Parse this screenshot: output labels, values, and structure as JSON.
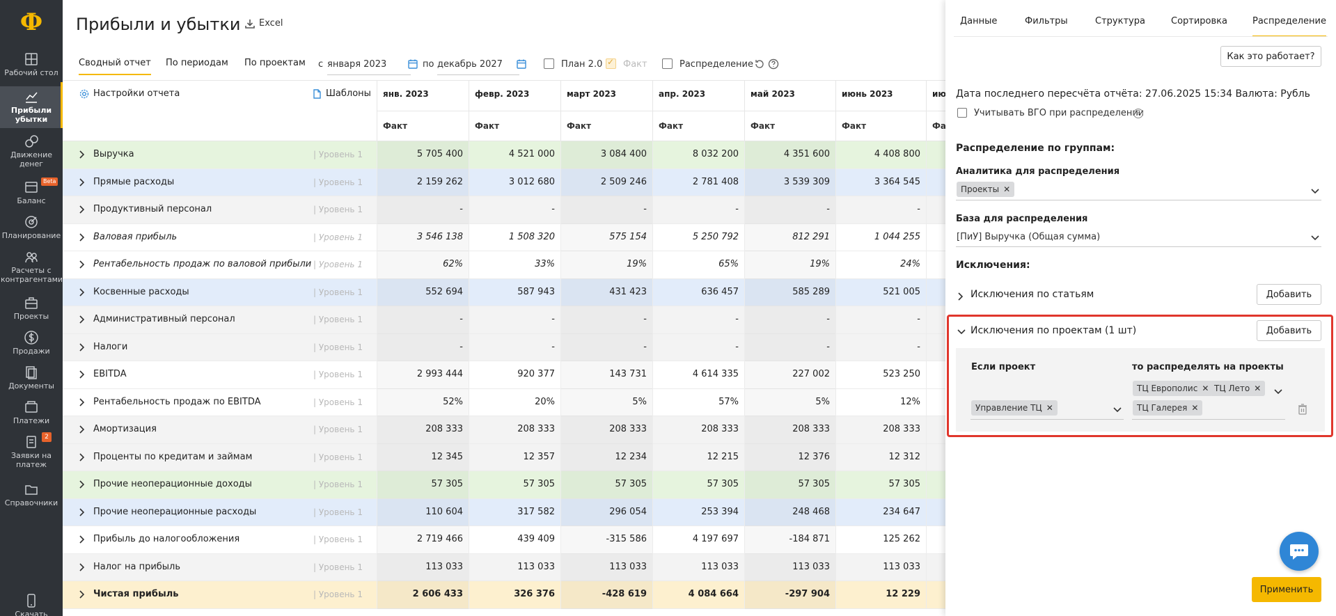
{
  "sidebar": {
    "logo": "Ф",
    "items": [
      {
        "label": "Рабочий стол",
        "icon": "dashboard-icon"
      },
      {
        "label": "Прибыли убытки",
        "icon": "chart-icon",
        "active": true
      },
      {
        "label": "Движение денег",
        "icon": "money-flow-icon"
      },
      {
        "label": "Баланс",
        "icon": "balance-icon",
        "badge": "Beta"
      },
      {
        "label": "Планирование",
        "icon": "target-icon"
      },
      {
        "label": "Расчеты с контрагентами",
        "icon": "contractors-icon"
      },
      {
        "label": "Проекты",
        "icon": "briefcase-icon"
      },
      {
        "label": "Продажи",
        "icon": "dollar-icon"
      },
      {
        "label": "Документы",
        "icon": "documents-icon"
      },
      {
        "label": "Платежи",
        "icon": "payments-icon"
      },
      {
        "label": "Заявки на платеж",
        "icon": "requests-icon",
        "badge": "2"
      },
      {
        "label": "Справочники",
        "icon": "folder-icon"
      },
      {
        "label": "Скачать",
        "icon": "phone-icon"
      }
    ]
  },
  "header": {
    "title": "Прибыли и убытки",
    "excel_label": "Excel"
  },
  "tabs": [
    {
      "label": "Сводный отчет",
      "active": true
    },
    {
      "label": "По периодам"
    },
    {
      "label": "По проектам"
    }
  ],
  "period": {
    "from_label": "с",
    "from_value": "января 2023",
    "to_label": "по",
    "to_value": "декабрь 2027"
  },
  "toggles": {
    "plan_label": "План 2.0",
    "fact_label": "Факт",
    "distribution_label": "Распределение"
  },
  "table": {
    "settings_label": "Настройки отчета",
    "templates_label": "Шаблоны",
    "months": [
      "янв. 2023",
      "февр. 2023",
      "март 2023",
      "апр. 2023",
      "май 2023",
      "июнь 2023",
      "июл"
    ],
    "sub_label": "Факт",
    "sub_label_cut": "Фа",
    "rows": [
      {
        "name": "Выручка",
        "level": "| Уровень 1",
        "style": "green",
        "bold": false,
        "values": [
          "5 705 400",
          "4 521 000",
          "3 084 400",
          "8 032 200",
          "4 351 600",
          "4 408 800"
        ]
      },
      {
        "name": "Прямые расходы",
        "level": "| Уровень 1",
        "style": "blue",
        "values": [
          "2 159 262",
          "3 012 680",
          "2 509 246",
          "2 781 408",
          "3 539 309",
          "3 364 545"
        ]
      },
      {
        "name": "Продуктивный персонал",
        "level": "| Уровень 1",
        "style": "gray",
        "values": [
          "-",
          "-",
          "-",
          "-",
          "-",
          "-"
        ]
      },
      {
        "name": "Валовая прибыль",
        "level": "| Уровень 1",
        "style": "white",
        "italic": true,
        "values": [
          "3 546 138",
          "1 508 320",
          "575 154",
          "5 250 792",
          "812 291",
          "1 044 255"
        ]
      },
      {
        "name": "Рентабельность продаж по валовой прибыли",
        "level": "| Уровень 1",
        "style": "white",
        "italic": true,
        "values": [
          "62%",
          "33%",
          "19%",
          "65%",
          "19%",
          "24%"
        ]
      },
      {
        "name": "Косвенные расходы",
        "level": "| Уровень 1",
        "style": "blue",
        "values": [
          "552 694",
          "587 943",
          "431 423",
          "636 457",
          "585 289",
          "521 005"
        ]
      },
      {
        "name": "Административный персонал",
        "level": "| Уровень 1",
        "style": "gray",
        "values": [
          "-",
          "-",
          "-",
          "-",
          "-",
          "-"
        ]
      },
      {
        "name": "Налоги",
        "level": "| Уровень 1",
        "style": "gray",
        "values": [
          "-",
          "-",
          "-",
          "-",
          "-",
          "-"
        ]
      },
      {
        "name": "EBITDA",
        "level": "| Уровень 1",
        "style": "white",
        "values": [
          "2 993 444",
          "920 377",
          "143 731",
          "4 614 335",
          "227 002",
          "523 250"
        ]
      },
      {
        "name": "Рентабельность продаж по EBITDA",
        "level": "| Уровень 1",
        "style": "white",
        "values": [
          "52%",
          "20%",
          "5%",
          "57%",
          "5%",
          "12%"
        ]
      },
      {
        "name": "Амортизация",
        "level": "| Уровень 1",
        "style": "gray",
        "values": [
          "208 333",
          "208 333",
          "208 333",
          "208 333",
          "208 333",
          "208 333"
        ]
      },
      {
        "name": "Проценты по кредитам и займам",
        "level": "| Уровень 1",
        "style": "gray",
        "values": [
          "12 345",
          "12 357",
          "12 234",
          "12 215",
          "12 376",
          "12 312"
        ]
      },
      {
        "name": "Прочие неоперационные доходы",
        "level": "| Уровень 1",
        "style": "green",
        "values": [
          "57 305",
          "57 305",
          "57 305",
          "57 305",
          "57 305",
          "57 305"
        ]
      },
      {
        "name": "Прочие неоперационные расходы",
        "level": "| Уровень 1",
        "style": "blue",
        "values": [
          "110 604",
          "317 582",
          "296 054",
          "253 394",
          "248 468",
          "234 647"
        ]
      },
      {
        "name": "Прибыль до налогообложения",
        "level": "| Уровень 1",
        "style": "white",
        "values": [
          "2 719 466",
          "439 409",
          "-315 586",
          "4 197 697",
          "-184 871",
          "125 262"
        ]
      },
      {
        "name": "Налог на прибыль",
        "level": "| Уровень 1",
        "style": "gray",
        "values": [
          "113 033",
          "113 033",
          "113 033",
          "113 033",
          "113 033",
          "113 033"
        ]
      },
      {
        "name": "Чистая прибыль",
        "level": "| Уровень 1",
        "style": "yellow",
        "bold": true,
        "values": [
          "2 606 433",
          "326 376",
          "-428 619",
          "4 084 664",
          "-297 904",
          "12 229"
        ]
      }
    ]
  },
  "panel": {
    "tabs": [
      "Данные",
      "Фильтры",
      "Структура",
      "Сортировка",
      "Распределение"
    ],
    "active_tab": "Распределение",
    "how_btn": "Как это работает?",
    "recalc_info": "Дата последнего пересчёта отчёта: 27.06.2025 15:34 Валюта: Рубль",
    "vgo_label": "Учитывать ВГО при распределении",
    "group_heading": "Распределение по группам:",
    "analytics_label": "Аналитика для распределения",
    "analytics_chip": "Проекты",
    "base_label": "База для распределения",
    "base_value": "[ПиУ] Выручка (Общая сумма)",
    "exclusions_heading": "Исключения:",
    "exc_articles": "Исключения по статьям",
    "exc_projects": "Исключения по проектам (1 шт)",
    "add_label": "Добавить",
    "if_project_label": "Если проект",
    "distribute_label": "то распределять на проекты",
    "if_project_chip": "Управление ТЦ",
    "target_chips": [
      "ТЦ Европолис",
      "ТЦ Лето",
      "ТЦ Галерея"
    ],
    "apply_label": "Применить"
  }
}
